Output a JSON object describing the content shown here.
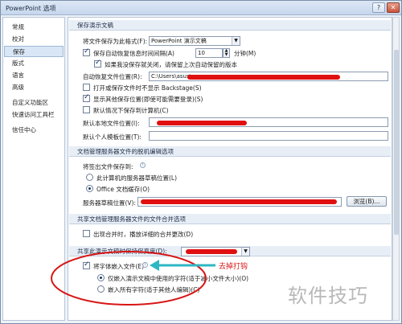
{
  "window": {
    "title": "PowerPoint 选项",
    "help_glyph": "?",
    "close_glyph": "✕"
  },
  "sidebar": {
    "items": [
      {
        "label": "常规"
      },
      {
        "label": "校对"
      },
      {
        "label": "保存",
        "active": true
      },
      {
        "label": "版式"
      },
      {
        "label": "语言"
      },
      {
        "label": "高级"
      },
      {
        "label": "自定义功能区"
      },
      {
        "label": "快速访问工具栏"
      },
      {
        "label": "信任中心"
      }
    ]
  },
  "save": {
    "header": "保存演示文稿",
    "format_label": "将文件保存为此格式(F):",
    "format_value": "PowerPoint 演示文稿",
    "autorecover_label": "保存自动恢复信息时间间隔(A)",
    "autorecover_value": "10",
    "minutes_label": "分钟(M)",
    "keep_last_label": "如果我没保存就关闭，请保留上次自动保留的版本",
    "autorecover_location_label": "自动恢复文件位置(R):",
    "autorecover_location_value": "C:\\Users\\asus\\",
    "no_backstage_label": "打开或保存文件时不显示 Backstage(S)",
    "show_other_locations_label": "显示其他保存位置(即使可能需要登录)(S)",
    "save_to_computer_label": "默认情况下保存到计算机(C)",
    "default_local_label": "默认本地文件位置(I):",
    "default_template_label": "默认个人模板位置(T):"
  },
  "offline": {
    "header": "文档管理服务器文件的脱机编辑选项",
    "checkout_label": "将签出文件保存到:",
    "radio_server": "此计算机的服务器草稿位置(L)",
    "radio_cache": "Office 文档缓存(O)",
    "drafts_label": "服务器草稿位置(V):",
    "browse_button": "浏览(B)..."
  },
  "merge": {
    "header": "共享文档管理服务器文件的文件合并选项",
    "show_changes_label": "出现合并时，播放详细的合并更改(D)"
  },
  "fidelity": {
    "header": "共享此演示文稿时保持保真度(D):",
    "embed_fonts_label": "将字体嵌入文件(E)",
    "embed_used_only_label": "仅嵌入演示文稿中使用的字符(适于减小文件大小)(O)",
    "embed_all_label": "嵌入所有字符(适于其他人编辑)(C)"
  },
  "annotation": {
    "label": "去掉打钩",
    "color": "#d81414"
  },
  "watermark": {
    "text": "软件技巧"
  }
}
